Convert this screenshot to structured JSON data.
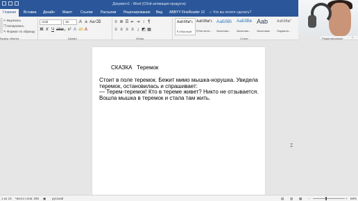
{
  "window": {
    "title": "Документ1 - Word (Сбой активации продукта)"
  },
  "tabs": [
    "Главная",
    "Вставка",
    "Дизайн",
    "Макет",
    "Ссылки",
    "Рассылки",
    "Рецензирование",
    "Вид",
    "ABBYY FineReader 12"
  ],
  "tell_me": "Что вы хотите сделать?",
  "clipboard": {
    "cut": "Вырезать",
    "copy": "Копировать",
    "format_painter": "Формат по образцу",
    "group": "Буфер обмена"
  },
  "font": {
    "name": "Arial",
    "size": "16",
    "group": "Шрифт"
  },
  "paragraph": {
    "group": "Абзац"
  },
  "styles": {
    "group": "Стили",
    "items": [
      {
        "sample": "АаБбВвГг,",
        "name": "¶ Обычный"
      },
      {
        "sample": "АаБбВвГг,",
        "name": "¶ Без инте..."
      },
      {
        "sample": "АаБбВі",
        "name": "Заголово..."
      },
      {
        "sample": "АаБбВв",
        "name": "Заголово..."
      },
      {
        "sample": "Aab",
        "name": "Заголовок"
      },
      {
        "sample": "АаБбВвГ",
        "name": "Подзагол..."
      }
    ]
  },
  "editing": {
    "group": "Редактирование"
  },
  "document": {
    "heading": "СКАЗКА   Теремок",
    "lines": [
      " Стоит в поле теремок. Бежит мимо мышка-норушка. Увидела",
      "теремок, остановилась и спрашивает:",
      "— Терем-теремок! Кто в тереме живет? Никто не отзывается.",
      "Вошла мышка в теремок и стала там жить."
    ]
  },
  "status": {
    "page": "1 из 13",
    "words": "Число слов: 296",
    "language": "русский",
    "zoom": "69%"
  }
}
